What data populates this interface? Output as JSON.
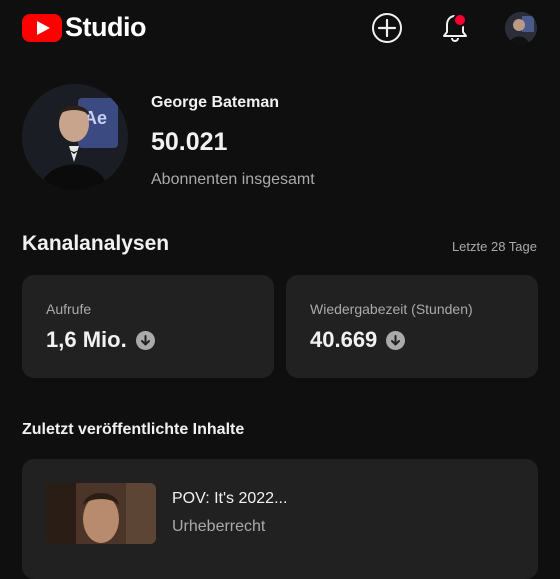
{
  "header": {
    "logo_text": "Studio",
    "create_icon": "plus-circle-icon",
    "notifications_icon": "bell-icon",
    "notification_badge_color": "#ff0033",
    "brand_color": "#ff0000"
  },
  "channel": {
    "name": "George Bateman",
    "subscribers": "50.021",
    "subscribers_label": "Abonnenten insgesamt",
    "avatar_overlay_text": "Ae"
  },
  "analytics": {
    "title": "Kanalanalysen",
    "period": "Letzte 28 Tage",
    "cards": [
      {
        "label": "Aufrufe",
        "value": "1,6 Mio.",
        "trend_icon": "arrow-down-circle-icon"
      },
      {
        "label": "Wiedergabezeit (Stunden)",
        "value": "40.669",
        "trend_icon": "arrow-down-circle-icon"
      }
    ]
  },
  "recent": {
    "title": "Zuletzt veröffentlichte Inhalte",
    "items": [
      {
        "title": "POV: It's 2022...",
        "status": "Urheberrecht"
      }
    ]
  }
}
